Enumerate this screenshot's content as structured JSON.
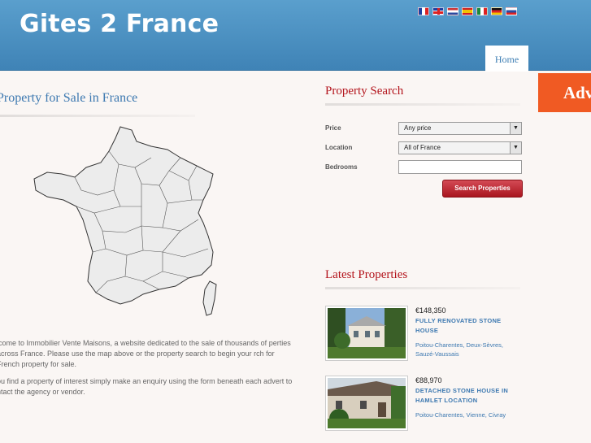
{
  "header": {
    "site_title": "Gites 2 France",
    "languages": [
      "French",
      "English",
      "Dutch",
      "Spanish",
      "Italian",
      "German",
      "Russian"
    ],
    "nav_home": "Home"
  },
  "left": {
    "title": "Property for Sale in France",
    "intro_1": "lcome to Immobilier Vente Maisons, a website dedicated to the sale of thousands of perties across France. Please use the map above or the property search to begin your rch for French property for sale.",
    "intro_2": "ou find a property of interest simply make an enquiry using the form beneath each advert to ntact the agency or vendor."
  },
  "search": {
    "title": "Property Search",
    "price_label": "Price",
    "price_value": "Any price",
    "location_label": "Location",
    "location_value": "All of France",
    "bedrooms_label": "Bedrooms",
    "bedrooms_value": "",
    "button": "Search Properties"
  },
  "ad": {
    "text": "Adv"
  },
  "latest": {
    "title": "Latest Properties",
    "items": [
      {
        "price": "€148,350",
        "title": "FULLY RENOVATED STONE HOUSE",
        "location": "Poitou-Charentes, Deux-Sèvres, Sauzé-Vaussais"
      },
      {
        "price": "€88,970",
        "title": "DETACHED STONE HOUSE IN HAMLET LOCATION",
        "location": "Poitou-Charentes, Vienne, Civray"
      }
    ]
  },
  "colors": {
    "header_blue": "#3f83b6",
    "accent_red": "#b3141c",
    "link_blue": "#3c78b0",
    "ad_orange": "#f05a23"
  }
}
